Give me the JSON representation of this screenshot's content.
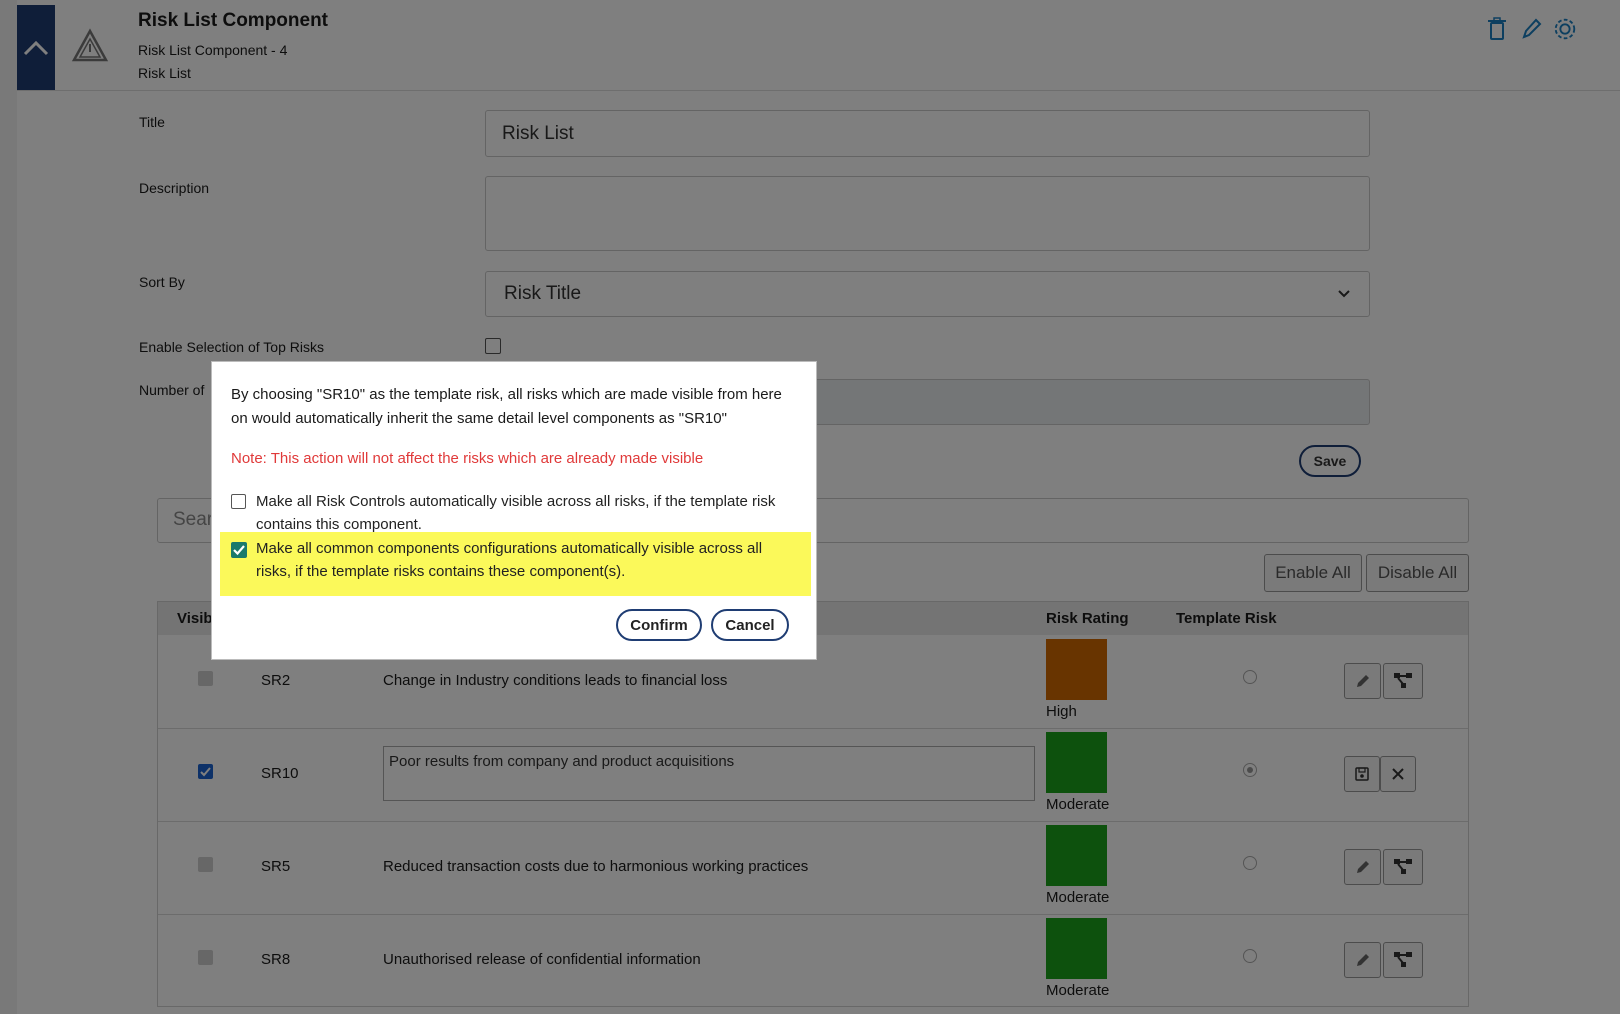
{
  "header": {
    "title": "Risk List Component",
    "subtitle": "Risk List Component - 4",
    "component_type": "Risk List"
  },
  "form": {
    "title_label": "Title",
    "title_value": "Risk List",
    "description_label": "Description",
    "description_value": "",
    "sort_label": "Sort By",
    "sort_value": "Risk Title",
    "top_risks_label": "Enable Selection of Top Risks",
    "top_risks_checked": false,
    "number_label": "Number of",
    "save_label": "Save"
  },
  "list": {
    "search_placeholder": "Sear",
    "enable_all": "Enable All",
    "disable_all": "Disable All",
    "headers": {
      "visible": "Visib",
      "risk_rating": "Risk Rating",
      "template_risk": "Template Risk"
    },
    "rows": [
      {
        "id": "SR2",
        "title": "Change in Industry conditions leads to financial loss",
        "rating": "High",
        "rating_color": "#d06900",
        "visible": "disabled",
        "template": false,
        "editing": false
      },
      {
        "id": "SR10",
        "title": "Poor results from company and product acquisitions",
        "rating": "Moderate",
        "rating_color": "#1aa31a",
        "visible": "checked",
        "template": true,
        "editing": true
      },
      {
        "id": "SR5",
        "title": "Reduced transaction costs due to harmonious working practices",
        "rating": "Moderate",
        "rating_color": "#1aa31a",
        "visible": "disabled",
        "template": false,
        "editing": false
      },
      {
        "id": "SR8",
        "title": "Unauthorised release of confidential information",
        "rating": "Moderate",
        "rating_color": "#1aa31a",
        "visible": "disabled",
        "template": false,
        "editing": false
      }
    ]
  },
  "modal": {
    "message": "By choosing \"SR10\" as the template risk, all risks which are made visible from here on would automatically inherit the same detail level components as \"SR10\"",
    "note": "Note: This action will not affect the risks which are already made visible",
    "option1": "Make all Risk Controls automatically visible across all risks, if the template risk contains this component.",
    "option1_checked": false,
    "option2": "Make all common components configurations automatically visible across all risks, if the template risks contains these component(s).",
    "option2_checked": true,
    "option2_highlight": "#fbf95a",
    "confirm": "Confirm",
    "cancel": "Cancel"
  },
  "colors": {
    "primary": "#1f3d73",
    "accent_icons": "#1b7fc1",
    "note_red": "#e03a3a"
  }
}
